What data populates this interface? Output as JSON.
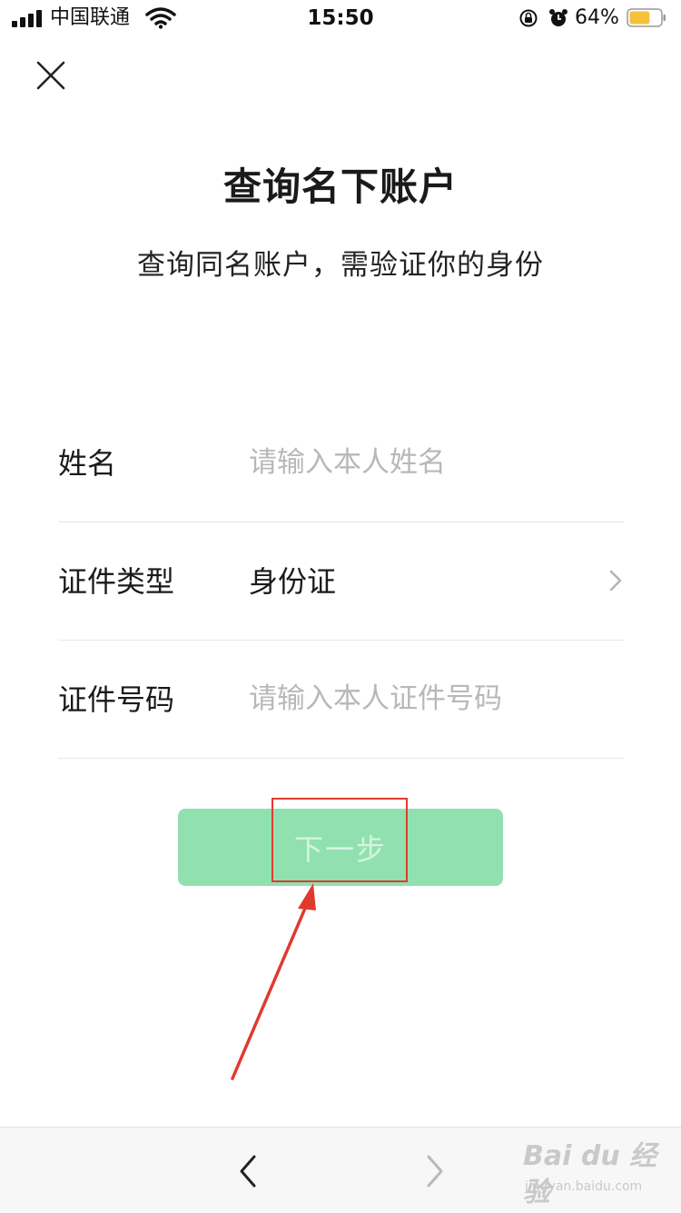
{
  "status_bar": {
    "carrier": "中国联通",
    "time": "15:50",
    "battery_percent": "64%",
    "battery_level": 0.64,
    "battery_color": "#f5c13a",
    "icons": [
      "signal-icon",
      "wifi-icon",
      "orientation-lock-icon",
      "alarm-icon",
      "battery-icon"
    ]
  },
  "header": {
    "close_icon": "close-icon",
    "title": "查询名下账户",
    "subtitle": "查询同名账户，需验证你的身份"
  },
  "form": {
    "name": {
      "label": "姓名",
      "placeholder": "请输入本人姓名",
      "value": ""
    },
    "id_type": {
      "label": "证件类型",
      "value": "身份证",
      "icon": "chevron-right-icon"
    },
    "id_number": {
      "label": "证件号码",
      "placeholder": "请输入本人证件号码",
      "value": ""
    }
  },
  "next_button": {
    "label": "下一步",
    "color": "#91e1b0",
    "enabled": false
  },
  "annotation": {
    "box_color": "#e03a2f",
    "arrow_color": "#e03a2f"
  },
  "bottom_bar": {
    "back_icon": "chevron-left-icon",
    "forward_icon": "chevron-right-icon",
    "watermark_main": "Bai du 经验",
    "watermark_sub": "jingyan.baidu.com"
  }
}
